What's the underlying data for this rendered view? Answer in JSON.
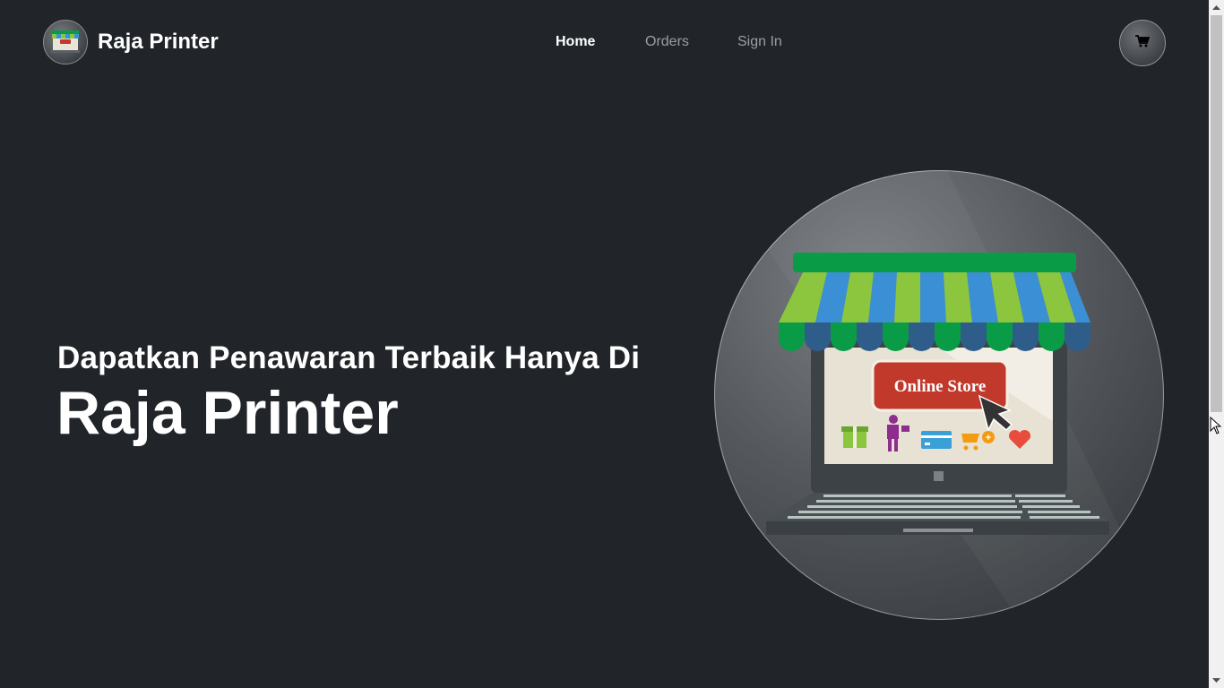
{
  "brand": {
    "name": "Raja Printer",
    "logo_icon": "storefront-icon"
  },
  "nav": {
    "items": [
      {
        "label": "Home",
        "active": true
      },
      {
        "label": "Orders",
        "active": false
      },
      {
        "label": "Sign In",
        "active": false
      }
    ]
  },
  "cart": {
    "icon": "cart-icon"
  },
  "hero": {
    "subtitle": "Dapatkan Penawaran Terbaik Hanya Di",
    "title": "Raja Printer",
    "image": {
      "sign_text": "Online Store"
    }
  },
  "colors": {
    "background": "#212529",
    "text": "#ffffff",
    "nav_inactive": "rgba(255,255,255,0.55)"
  }
}
